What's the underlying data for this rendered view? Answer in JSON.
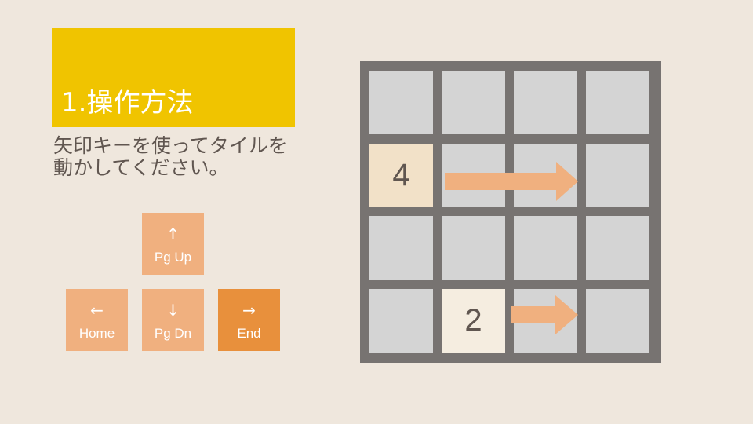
{
  "slide": {
    "title": "1.操作方法",
    "instruction": "矢印キーを使ってタイルを動かしてください。"
  },
  "keys": [
    {
      "id": "up",
      "arrow": "↑",
      "label": "Pg Up",
      "active": false
    },
    {
      "id": "left",
      "arrow": "←",
      "label": "Home",
      "active": false
    },
    {
      "id": "down",
      "arrow": "↓",
      "label": "Pg Dn",
      "active": false
    },
    {
      "id": "right",
      "arrow": "→",
      "label": "End",
      "active": true
    }
  ],
  "board": {
    "size": 4,
    "tiles": [
      {
        "row": 1,
        "col": 0,
        "value": "4"
      },
      {
        "row": 3,
        "col": 1,
        "value": "2"
      }
    ],
    "move_direction": "right"
  },
  "colors": {
    "title_bg": "#f0c400",
    "key_bg": "#f0b07f",
    "key_active_bg": "#e8903c",
    "board_bg": "#777371",
    "cell_bg": "#d4d4d4",
    "arrow": "#f0b07f"
  }
}
